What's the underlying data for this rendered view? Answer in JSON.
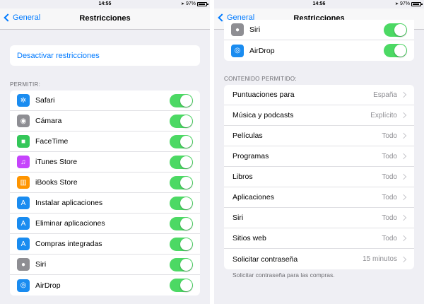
{
  "left": {
    "status": {
      "time": "14:55",
      "battery": "97%"
    },
    "nav": {
      "back_label": "General",
      "title": "Restricciones"
    },
    "disable_link": "Desactivar restricciones",
    "allow_header": "PERMITIR:",
    "allow_items": [
      {
        "label": "Safari",
        "icon": "compass-icon",
        "color": "#1a8cf0",
        "glyph": "✲"
      },
      {
        "label": "Cámara",
        "icon": "camera-icon",
        "color": "#8e8e93",
        "glyph": "◉"
      },
      {
        "label": "FaceTime",
        "icon": "video-camera-icon",
        "color": "#34c759",
        "glyph": "■"
      },
      {
        "label": "iTunes Store",
        "icon": "music-note-icon",
        "color": "#c644fc",
        "glyph": "♫"
      },
      {
        "label": "iBooks Store",
        "icon": "book-icon",
        "color": "#ff9500",
        "glyph": "▥"
      },
      {
        "label": "Instalar aplicaciones",
        "icon": "app-store-icon",
        "color": "#1a8cf0",
        "glyph": "A"
      },
      {
        "label": "Eliminar aplicaciones",
        "icon": "app-store-icon",
        "color": "#1a8cf0",
        "glyph": "A"
      },
      {
        "label": "Compras integradas",
        "icon": "app-store-icon",
        "color": "#1a8cf0",
        "glyph": "A"
      },
      {
        "label": "Siri",
        "icon": "microphone-icon",
        "color": "#8e8e93",
        "glyph": "●"
      },
      {
        "label": "AirDrop",
        "icon": "airdrop-icon",
        "color": "#1a8cf0",
        "glyph": "◎"
      }
    ]
  },
  "right": {
    "status": {
      "time": "14:56",
      "battery": "97%"
    },
    "nav": {
      "back_label": "General",
      "title": "Restricciones"
    },
    "top_items": [
      {
        "label": "Siri",
        "icon": "microphone-icon",
        "color": "#8e8e93",
        "glyph": "●"
      },
      {
        "label": "AirDrop",
        "icon": "airdrop-icon",
        "color": "#1a8cf0",
        "glyph": "◎"
      }
    ],
    "content_header": "CONTENIDO PERMITIDO:",
    "content_items": [
      {
        "label": "Puntuaciones para",
        "value": "España"
      },
      {
        "label": "Música y podcasts",
        "value": "Explícito"
      },
      {
        "label": "Películas",
        "value": "Todo"
      },
      {
        "label": "Programas",
        "value": "Todo"
      },
      {
        "label": "Libros",
        "value": "Todo"
      },
      {
        "label": "Aplicaciones",
        "value": "Todo"
      },
      {
        "label": "Siri",
        "value": "Todo"
      },
      {
        "label": "Sitios web",
        "value": "Todo"
      },
      {
        "label": "Solicitar contraseña",
        "value": "15 minutos"
      }
    ],
    "footer_note": "Solicitar contraseña para las compras."
  },
  "colors": {
    "accent": "#007aff",
    "toggle_on": "#4cd964",
    "background": "#efeff4"
  }
}
